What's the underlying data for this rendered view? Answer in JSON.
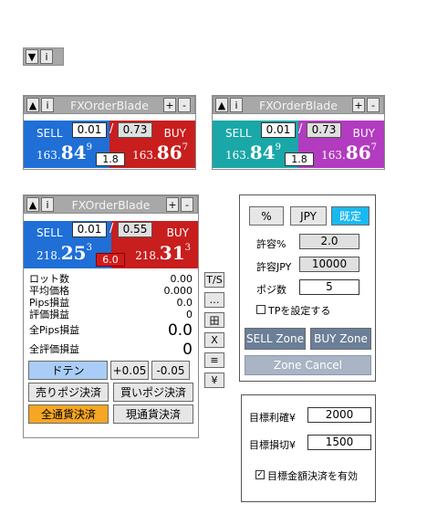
{
  "mini": {
    "collapse": "▼",
    "info": "i"
  },
  "window1": {
    "title": "FXOrderBlade",
    "up": "▲",
    "info": "i",
    "plus": "+",
    "minus": "-",
    "sell_label": "SELL",
    "buy_label": "BUY",
    "sell_lot": "0.01",
    "buy_lot": "0.73",
    "slash": "/",
    "sell_a": "163.",
    "sell_b": "84",
    "sell_c": "9",
    "buy_a": "163.",
    "buy_b": "86",
    "buy_c": "7",
    "spread": "1.8"
  },
  "window2": {
    "title": "FXOrderBlade",
    "up": "▲",
    "info": "i",
    "plus": "+",
    "minus": "-",
    "sell_label": "SELL",
    "buy_label": "BUY",
    "sell_lot": "0.01",
    "buy_lot": "0.73",
    "slash": "/",
    "sell_a": "163.",
    "sell_b": "84",
    "sell_c": "9",
    "buy_a": "163.",
    "buy_b": "86",
    "buy_c": "7",
    "spread": "1.8"
  },
  "window3": {
    "title": "FXOrderBlade",
    "up": "▲",
    "info": "i",
    "plus": "+",
    "minus": "-",
    "sell_label": "SELL",
    "buy_label": "BUY",
    "sell_lot": "0.01",
    "buy_lot": "0.55",
    "slash": "/",
    "sell_a": "218.",
    "sell_b": "25",
    "sell_c": "3",
    "buy_a": "218.",
    "buy_b": "31",
    "buy_c": "3",
    "spread": "6.0",
    "stats": [
      {
        "label": "ロット数",
        "value": "0.00"
      },
      {
        "label": "平均価格",
        "value": "0.000"
      },
      {
        "label": "Pips損益",
        "value": "0.0"
      },
      {
        "label": "評価損益",
        "value": "0"
      }
    ],
    "all_pips_label": "全Pips損益",
    "all_pips_value": "0.0",
    "all_eval_label": "全評価損益",
    "all_eval_value": "0",
    "doten": "ドテン",
    "plus005": "+0.05",
    "minus005": "-0.05",
    "close_sell": "売りポジ決済",
    "close_buy": "買いポジ決済",
    "close_all": "全通貨決済",
    "close_current": "現通貨決済",
    "side": [
      "T/S",
      "…",
      "田",
      "X",
      "≡",
      "¥"
    ]
  },
  "settings": {
    "pct": "%",
    "jpy": "JPY",
    "existing": "既定",
    "allow_pct_label": "許容%",
    "allow_pct_value": "2.0",
    "allow_jpy_label": "許容JPY",
    "allow_jpy_value": "10000",
    "pos_label": "ポジ数",
    "pos_value": "5",
    "tp_label": "TPを設定する",
    "sell_zone": "SELL Zone",
    "buy_zone": "BUY Zone",
    "zone_cancel": "Zone Cancel"
  },
  "target": {
    "profit_label": "目標利確¥",
    "profit_value": "2000",
    "loss_label": "目標損切¥",
    "loss_value": "1500",
    "enable_label": "目標金額決済を有効"
  }
}
